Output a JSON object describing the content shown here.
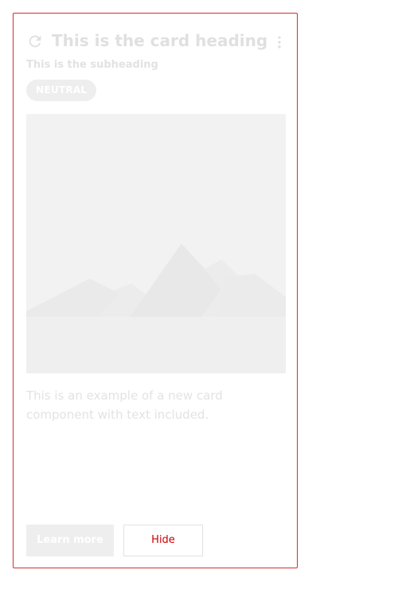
{
  "card": {
    "heading": "This is the card heading",
    "subheading": "This is the subheading",
    "badge": "NEUTRAL",
    "body": "This is an example of a new card component with text included.",
    "actions": {
      "primary_label": "Learn more",
      "secondary_label": "Hide"
    },
    "header_icons": {
      "left": "refresh-icon",
      "right": "more-vertical-icon"
    },
    "media_icon": "mountain-placeholder-image"
  },
  "colors": {
    "card_border": "#d32f2f",
    "muted_text": "#e0e0e0",
    "secondary_button_text": "#cc0000"
  }
}
